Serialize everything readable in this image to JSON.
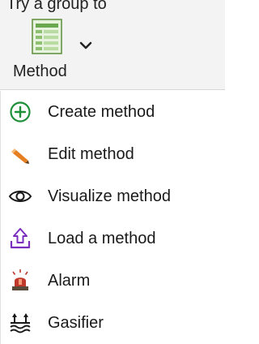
{
  "ribbon": {
    "partial_title": "Try a group to",
    "method_button_label": "Method"
  },
  "menu": {
    "items": [
      {
        "label": "Create method",
        "icon": "plus-circle-icon"
      },
      {
        "label": "Edit method",
        "icon": "pencil-icon"
      },
      {
        "label": "Visualize method",
        "icon": "eye-icon"
      },
      {
        "label": "Load a method",
        "icon": "upload-icon"
      },
      {
        "label": "Alarm",
        "icon": "alarm-siren-icon"
      },
      {
        "label": "Gasifier",
        "icon": "gasifier-icon"
      }
    ]
  },
  "colors": {
    "create_green": "#1f8f3a",
    "edit_orange": "#e67e22",
    "load_purple": "#7b2fbf",
    "alarm_red": "#c0392b",
    "doc_green": "#6aa84f"
  }
}
